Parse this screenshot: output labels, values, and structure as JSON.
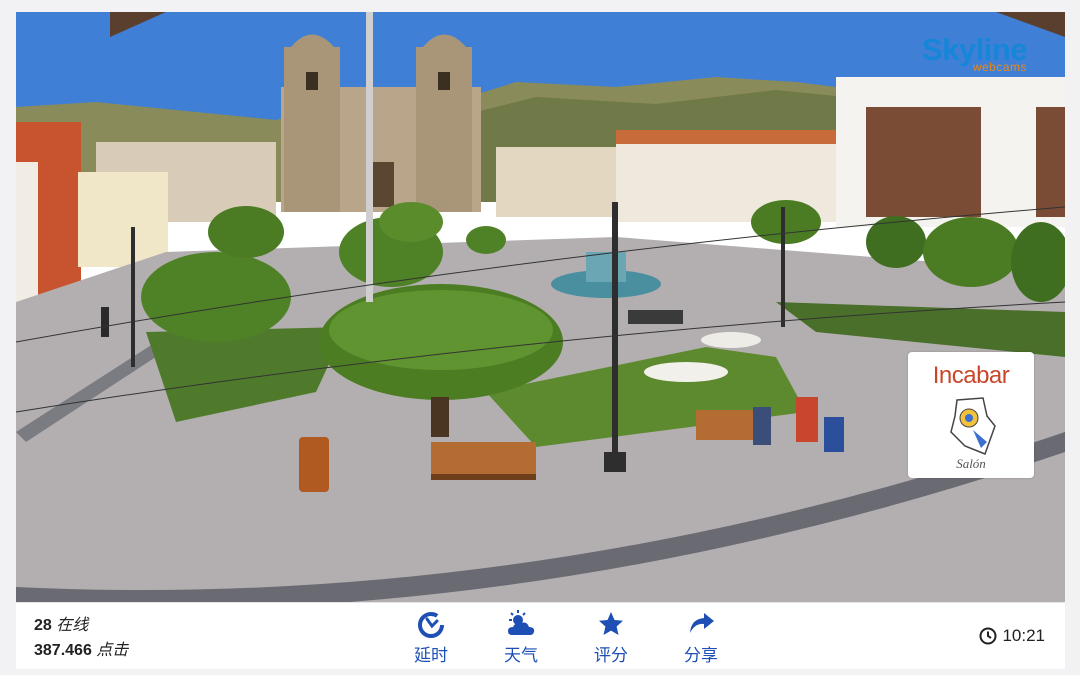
{
  "brand": {
    "name": "Skyline",
    "sub": "webcams"
  },
  "sponsor": {
    "title": "Incabar",
    "subtitle": "Salón"
  },
  "stats": {
    "online_count": "28",
    "online_label": "在线",
    "clicks_count": "387.466",
    "clicks_label": "点击"
  },
  "actions": [
    {
      "label": "延时",
      "icon": "timelapse-icon"
    },
    {
      "label": "天气",
      "icon": "weather-icon"
    },
    {
      "label": "评分",
      "icon": "star-icon"
    },
    {
      "label": "分享",
      "icon": "share-icon"
    }
  ],
  "clock": {
    "time": "10:21",
    "icon": "clock-icon"
  },
  "colors": {
    "accent": "#1d4fb4",
    "brand_blue": "#1686d8",
    "brand_orange": "#e8891c"
  }
}
